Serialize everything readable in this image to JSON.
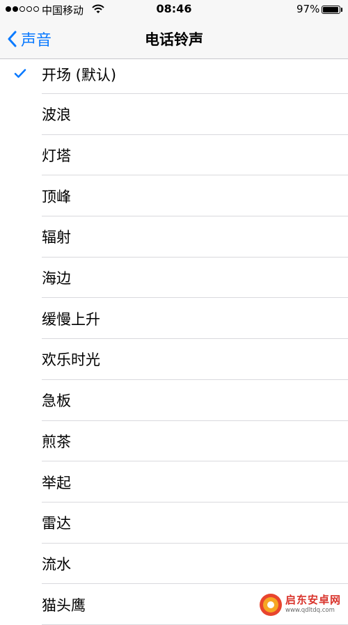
{
  "status_bar": {
    "signal_filled": 2,
    "signal_total": 5,
    "carrier": "中国移动",
    "time": "08:46",
    "battery_percent": "97%",
    "battery_level": 0.97
  },
  "nav": {
    "back_label": "声音",
    "title": "电话铃声"
  },
  "ringtones": {
    "selected_index": 0,
    "items": [
      {
        "label": "开场 (默认)"
      },
      {
        "label": "波浪"
      },
      {
        "label": "灯塔"
      },
      {
        "label": "顶峰"
      },
      {
        "label": "辐射"
      },
      {
        "label": "海边"
      },
      {
        "label": "缓慢上升"
      },
      {
        "label": "欢乐时光"
      },
      {
        "label": "急板"
      },
      {
        "label": "煎茶"
      },
      {
        "label": "举起"
      },
      {
        "label": "雷达"
      },
      {
        "label": "流水"
      },
      {
        "label": "猫头鹰"
      }
    ]
  },
  "watermark": {
    "title": "启东安卓网",
    "url": "www.qdltdq.com"
  },
  "colors": {
    "accent": "#0a7aff",
    "bar_background": "#f7f7f7",
    "separator": "#d9d9dd",
    "watermark_red": "#d9332b"
  },
  "icons": {
    "back": "chevron-left-icon",
    "selected": "checkmark-icon",
    "wifi": "wifi-icon",
    "battery": "battery-icon"
  }
}
